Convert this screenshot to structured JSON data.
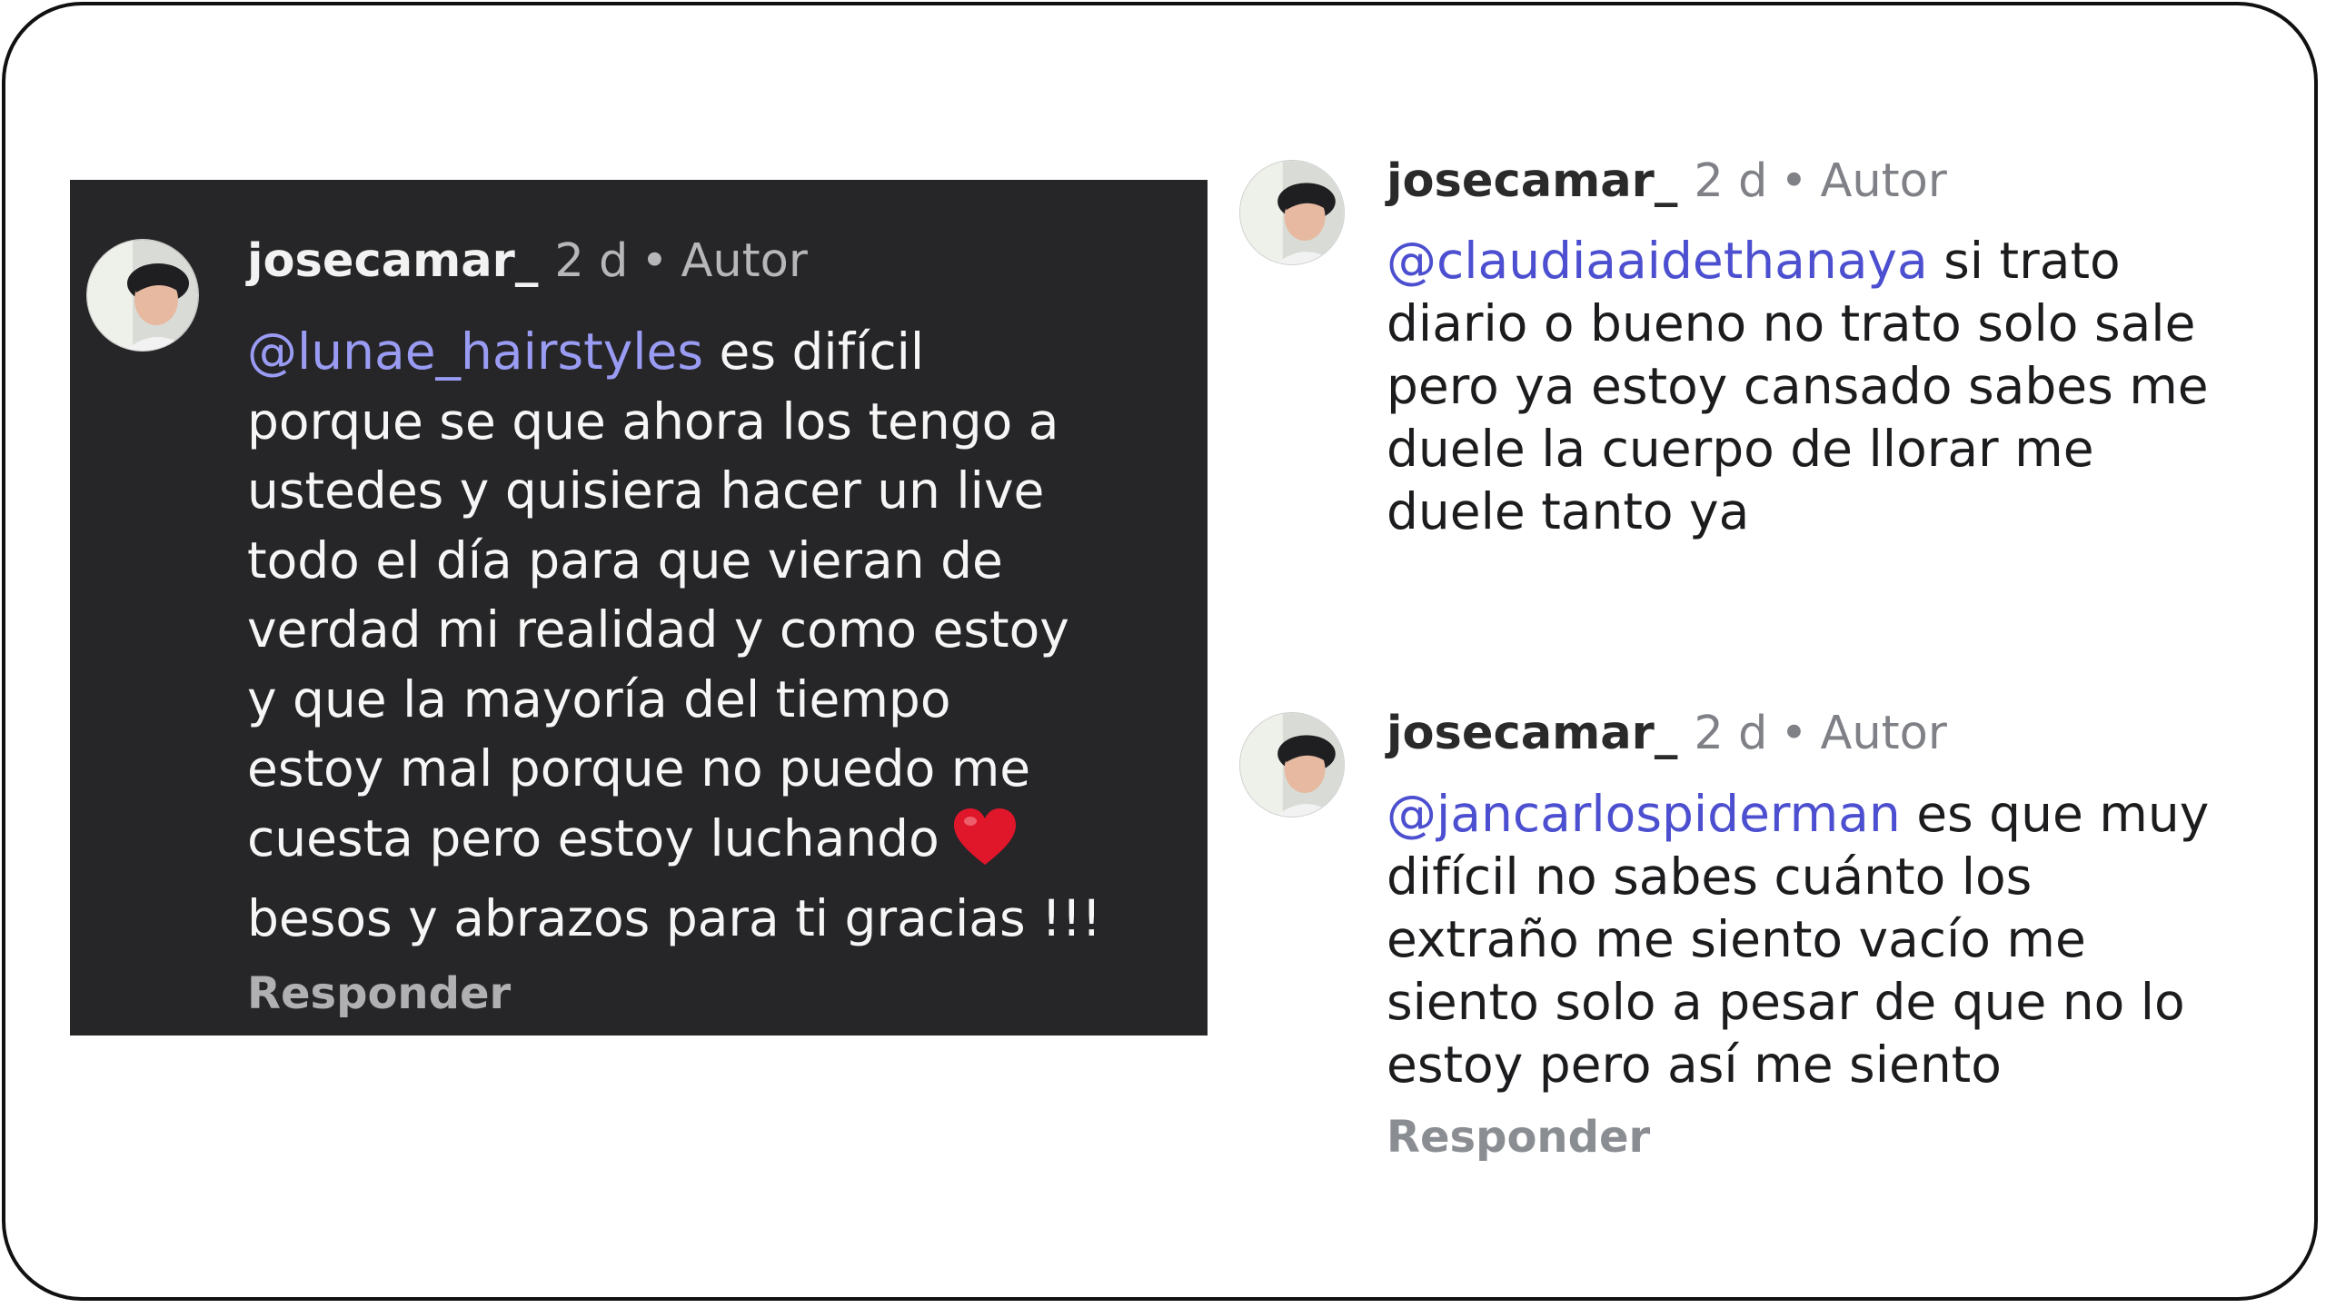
{
  "comments": [
    {
      "theme": "dark",
      "username": "josecamar_",
      "time": "2 d",
      "separator": "•",
      "badge": "Autor",
      "mention": "@lunae_hairstyles",
      "lines": [
        "es difícil",
        "porque se que ahora los tengo a",
        "ustedes y quisiera hacer un live",
        "todo el día para que vieran de",
        "verdad mi realidad y como estoy",
        "y que la mayoría del tiempo",
        "estoy mal porque no puedo me",
        "cuesta pero estoy luchando",
        "besos y abrazos para ti gracias !!!"
      ],
      "reply_label": "Responder"
    },
    {
      "theme": "light",
      "username": "josecamar_",
      "time": "2 d",
      "separator": "•",
      "badge": "Autor",
      "mention": "@claudiaaidethanaya",
      "lines": [
        "si trato",
        "diario o bueno no trato solo sale",
        "pero ya estoy cansado sabes me",
        "duele la cuerpo de llorar me",
        "duele tanto ya"
      ]
    },
    {
      "theme": "light",
      "username": "josecamar_",
      "time": "2 d",
      "separator": "•",
      "badge": "Autor",
      "mention": "@jancarlospiderman",
      "lines": [
        "es que muy",
        "difícil no sabes cuánto los",
        "extraño me siento vacío me",
        "siento solo a pesar de que no lo",
        "estoy pero así me siento"
      ],
      "reply_label": "Responder"
    }
  ],
  "icons": {
    "avatar": "profile-photo-avatar",
    "heart": "red-heart-emoji"
  },
  "colors": {
    "dark_card_bg": "#262527",
    "mention_dark": "#9a9cf4",
    "mention_light": "#4c4fcf",
    "heart": "#e0162b"
  }
}
